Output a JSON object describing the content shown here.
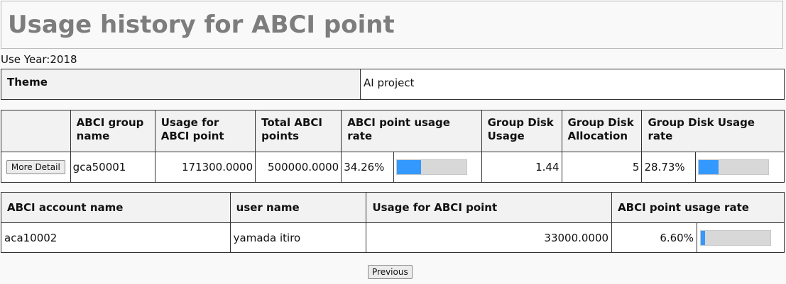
{
  "page": {
    "title": "Usage history for ABCI point"
  },
  "use_year": {
    "label": "Use Year:",
    "value": "2018"
  },
  "theme": {
    "header": "Theme",
    "value": "AI project"
  },
  "group_table": {
    "headers": {
      "blank": "",
      "group_name": "ABCI group name",
      "usage": "Usage for ABCI point",
      "total": "Total ABCI points",
      "rate": "ABCI point usage rate",
      "disk_usage": "Group Disk Usage",
      "disk_alloc": "Group Disk Allocation",
      "disk_rate": "Group Disk Usage rate"
    },
    "row": {
      "button_label": "More Detail",
      "group_name": "gca50001",
      "usage": "171300.0000",
      "total": "500000.0000",
      "rate_text": "34.26%",
      "rate_value": 0.3426,
      "disk_usage": "1.44",
      "disk_alloc": "5",
      "disk_rate_text": "28.73%",
      "disk_rate_value": 0.2873
    }
  },
  "account_table": {
    "headers": {
      "account": "ABCI account name",
      "user": "user name",
      "usage": "Usage for ABCI point",
      "rate": "ABCI point usage rate"
    },
    "row": {
      "account": "aca10002",
      "user": "yamada itiro",
      "usage": "33000.0000",
      "rate_text": "6.60%",
      "rate_value": 0.066
    }
  },
  "previous_button": "Previous",
  "colors": {
    "bar_fill": "#3399ff",
    "bar_track": "#d8d8d8",
    "title": "#7d7d7d"
  }
}
